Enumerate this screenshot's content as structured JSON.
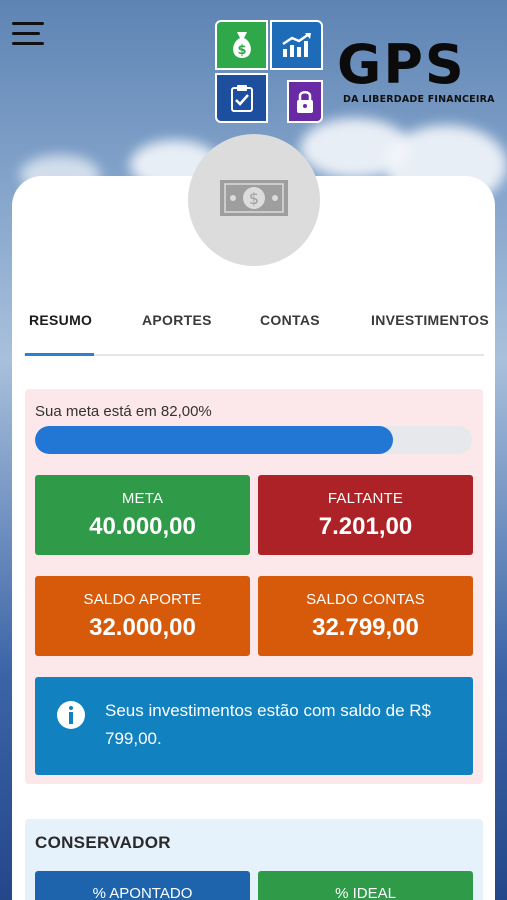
{
  "header": {
    "menu_icon": "hamburger-menu-icon",
    "brand_name": "GPS",
    "brand_tagline": "DA LIBERDADE FINANCEIRA",
    "logo_icons": [
      "money-bag-icon",
      "growth-chart-icon",
      "clipboard-check-icon",
      "padlock-icon"
    ]
  },
  "avatar": {
    "icon": "banknote-icon"
  },
  "tabs": [
    {
      "label": "RESUMO",
      "active": true
    },
    {
      "label": "APORTES",
      "active": false
    },
    {
      "label": "CONTAS",
      "active": false
    },
    {
      "label": "INVESTIMENTOS",
      "active": false
    }
  ],
  "summary": {
    "goal_text": "Sua meta está em 82,00%",
    "progress_fraction": 0.82,
    "stats": [
      {
        "label": "META",
        "value": "40.000,00",
        "color": "#2f9a47"
      },
      {
        "label": "FALTANTE",
        "value": "7.201,00",
        "color": "#ad2227"
      },
      {
        "label": "SALDO APORTE",
        "value": "32.000,00",
        "color": "#d75a0a"
      },
      {
        "label": "SALDO CONTAS",
        "value": "32.799,00",
        "color": "#d75a0a"
      }
    ],
    "info": {
      "icon": "info-icon",
      "text": "Seus investimentos estão com saldo de R$ 799,00."
    }
  },
  "profile": {
    "title": "CONSERVADOR",
    "buttons": [
      {
        "label": "% APONTADO",
        "color": "#1d64ad"
      },
      {
        "label": "% IDEAL",
        "color": "#2f9a47"
      }
    ]
  },
  "colors": {
    "accent": "#2d7fd3",
    "progress": "#2177d3",
    "info_bg": "#1181c0",
    "summary_bg": "#fce8ea",
    "profile_bg": "#e5f1fb"
  }
}
